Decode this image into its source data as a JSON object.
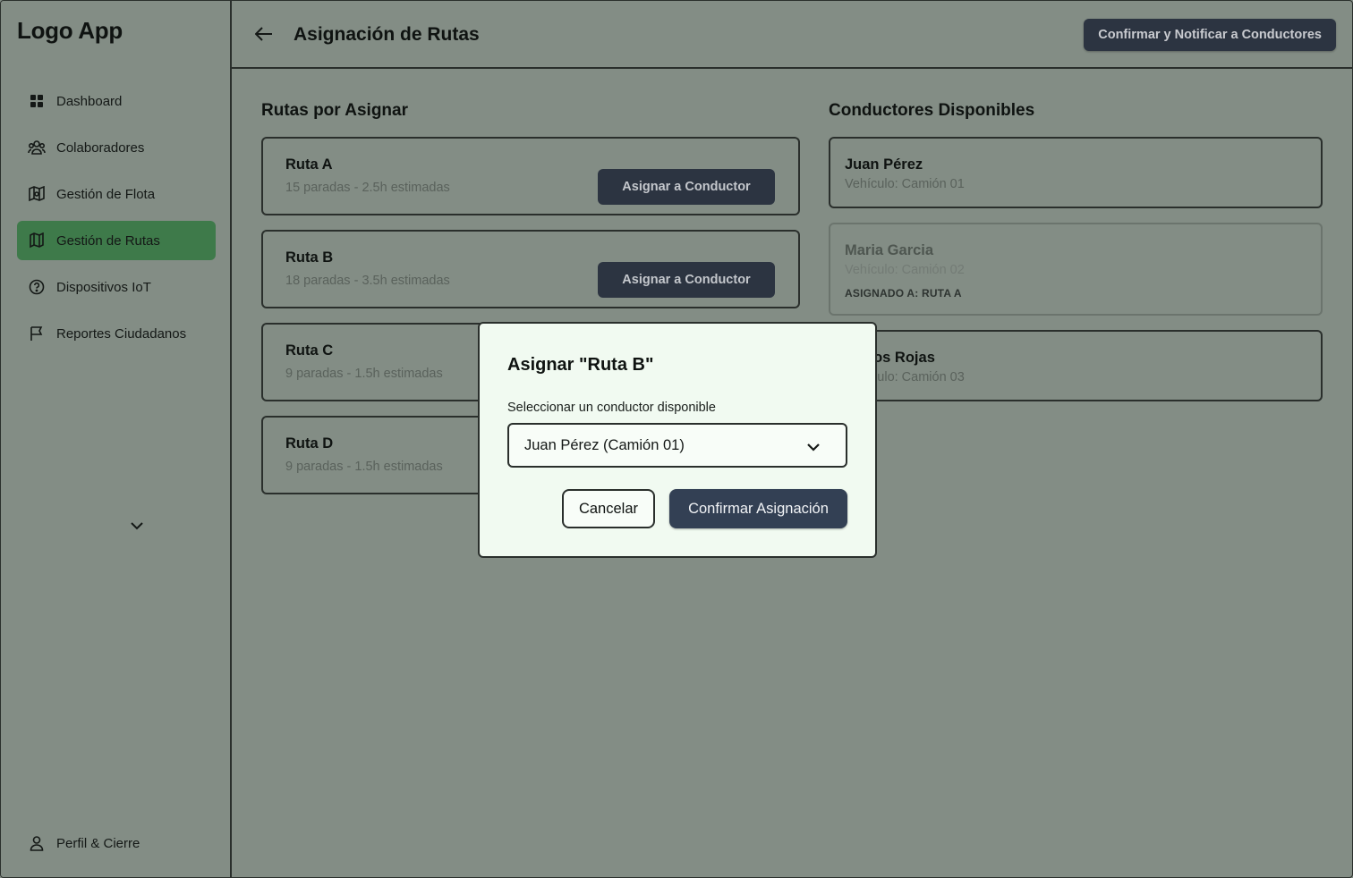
{
  "app": {
    "logo": "Logo App"
  },
  "sidebar": {
    "items": [
      {
        "label": "Dashboard",
        "icon": "grid-icon"
      },
      {
        "label": "Colaboradores",
        "icon": "users-icon"
      },
      {
        "label": "Gestión de Flota",
        "icon": "fleet-icon"
      },
      {
        "label": "Gestión de Rutas",
        "icon": "map-icon",
        "active": true
      },
      {
        "label": "Dispositivos IoT",
        "icon": "help-circle-icon"
      },
      {
        "label": "Reportes Ciudadanos",
        "icon": "flag-icon"
      }
    ],
    "profile": "Perfil & Cierre"
  },
  "header": {
    "title": "Asignación de Rutas",
    "confirm_notify": "Confirmar y Notificar a Conductores"
  },
  "routes": {
    "title": "Rutas por Asignar",
    "assign_label": "Asignar a Conductor",
    "items": [
      {
        "name": "Ruta A",
        "meta": "15 paradas - 2.5h estimadas"
      },
      {
        "name": "Ruta B",
        "meta": "18 paradas - 3.5h estimadas"
      },
      {
        "name": "Ruta C",
        "meta": "9 paradas - 1.5h estimadas"
      },
      {
        "name": "Ruta D",
        "meta": "9 paradas - 1.5h estimadas"
      }
    ]
  },
  "drivers": {
    "title": "Conductores Disponibles",
    "items": [
      {
        "name": "Juan Pérez",
        "meta": "Vehículo: Camión 01"
      },
      {
        "name": "Maria Garcia",
        "meta": "Vehículo: Camión 02",
        "assigned": "ASIGNADO A: RUTA A"
      },
      {
        "name": "Carlos Rojas",
        "meta": "Vehículo: Camión 03"
      }
    ]
  },
  "modal": {
    "title": "Asignar \"Ruta B\"",
    "label": "Seleccionar un conductor disponible",
    "selected": "Juan Pérez (Camión 01)",
    "cancel": "Cancelar",
    "confirm": "Confirmar Asignación"
  },
  "colors": {
    "active_nav": "#3e7a4a",
    "dark_button": "#2c3441",
    "modal_bg": "#f1faf1"
  }
}
